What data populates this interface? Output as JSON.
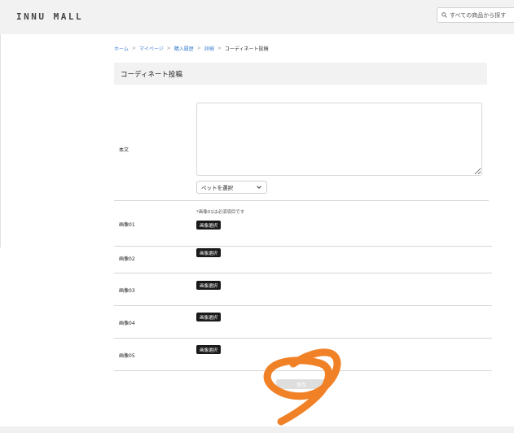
{
  "header": {
    "logo": "INNU MALL",
    "search_placeholder": "すべての商品から探す"
  },
  "breadcrumb": {
    "items": [
      "ホーム",
      "マイページ",
      "購入履歴",
      "詳細"
    ],
    "current": "コーディネート投稿",
    "separator": ">"
  },
  "page": {
    "title": "コーディネート投稿"
  },
  "form": {
    "body_label": "本文",
    "body_value": "",
    "pet_select": {
      "selected": "ペットを選択"
    },
    "images_note": "*画像01は必須項目です",
    "image_button_label": "画像選択",
    "image_labels": [
      "画像01",
      "画像02",
      "画像03",
      "画像04",
      "画像05"
    ],
    "save_label": "保存"
  },
  "colors": {
    "link": "#3d7fd0",
    "annotation": "#f07a1a",
    "button_dark": "#1a1a1a",
    "save_disabled": "#dedede"
  }
}
